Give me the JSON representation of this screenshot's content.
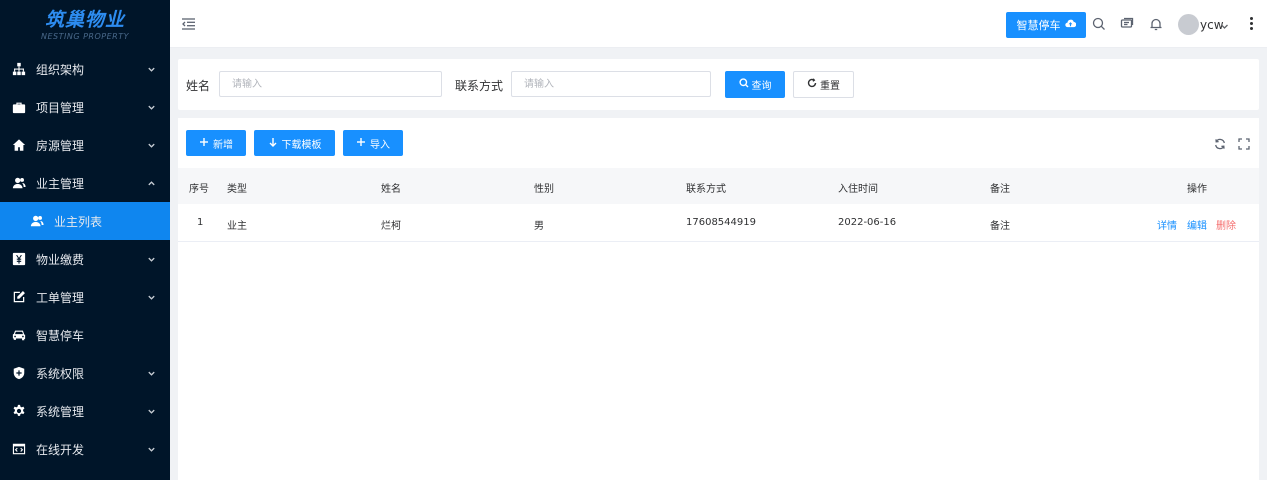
{
  "logo": {
    "main": "筑巢物业",
    "sub": "NESTING PROPERTY"
  },
  "sidebar": {
    "items": [
      {
        "label": "组织架构",
        "icon": "org-chart-icon",
        "arrow": "down"
      },
      {
        "label": "项目管理",
        "icon": "briefcase-icon",
        "arrow": "down"
      },
      {
        "label": "房源管理",
        "icon": "home-icon",
        "arrow": "down"
      },
      {
        "label": "业主管理",
        "icon": "user-group-icon",
        "arrow": "up"
      },
      {
        "label": "业主列表",
        "icon": "user-group-icon",
        "active": true
      },
      {
        "label": "物业缴费",
        "icon": "yuan-icon",
        "arrow": "down"
      },
      {
        "label": "工单管理",
        "icon": "edit-document-icon",
        "arrow": "down"
      },
      {
        "label": "智慧停车",
        "icon": "car-icon"
      },
      {
        "label": "系统权限",
        "icon": "shield-icon",
        "arrow": "down"
      },
      {
        "label": "系统管理",
        "icon": "settings-icon",
        "arrow": "down"
      },
      {
        "label": "在线开发",
        "icon": "code-window-icon",
        "arrow": "down"
      }
    ]
  },
  "header": {
    "park_button": "智慧停车",
    "username": "ycw"
  },
  "search": {
    "name_label": "姓名",
    "name_placeholder": "请输入",
    "contact_label": "联系方式",
    "contact_placeholder": "请输入",
    "query_button": "查询",
    "reset_button": "重置"
  },
  "toolbar": {
    "add_button": "新增",
    "download_button": "下载模板",
    "import_button": "导入"
  },
  "table": {
    "columns": [
      "序号",
      "类型",
      "姓名",
      "性别",
      "联系方式",
      "入住时间",
      "备注",
      "操作"
    ],
    "rows": [
      {
        "index": "1",
        "type": "业主",
        "name": "烂柯",
        "gender": "男",
        "contact": "17608544919",
        "checkin": "2022-06-16",
        "remark": "备注",
        "actions": {
          "detail": "详情",
          "edit": "编辑",
          "delete": "删除"
        }
      }
    ]
  },
  "colors": {
    "sidebar_bg": "#001529",
    "active_menu": "#0f86ef",
    "primary": "#1890ff",
    "danger": "#f56c6c"
  }
}
